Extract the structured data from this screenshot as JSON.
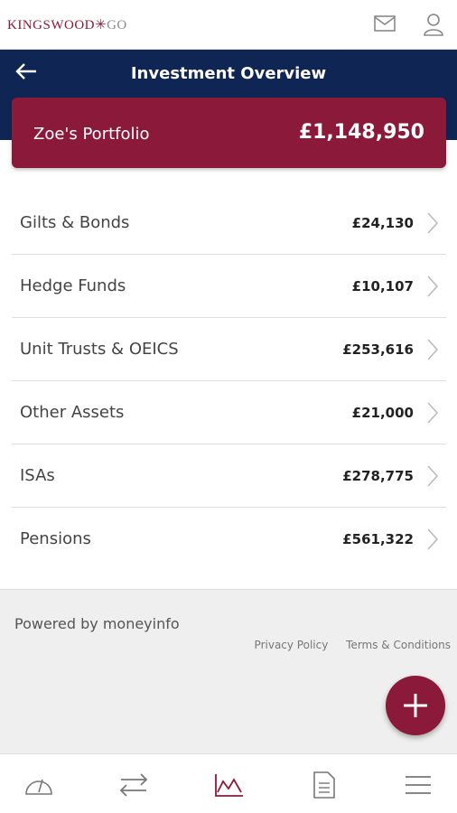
{
  "app": {
    "brand_left": "KINGSWOOD",
    "brand_sep": "✳",
    "brand_right": "GO"
  },
  "header": {
    "title": "Investment Overview"
  },
  "portfolio": {
    "name": "Zoe's Portfolio",
    "total": "£1,148,950"
  },
  "assets": [
    {
      "label": "Gilts & Bonds",
      "value": "£24,130"
    },
    {
      "label": "Hedge Funds",
      "value": "£10,107"
    },
    {
      "label": "Unit Trusts & OEICS",
      "value": "£253,616"
    },
    {
      "label": "Other Assets",
      "value": "£21,000"
    },
    {
      "label": "ISAs",
      "value": "£278,775"
    },
    {
      "label": "Pensions",
      "value": "£561,322"
    }
  ],
  "footer": {
    "powered": "Powered by moneyinfo",
    "privacy": "Privacy Policy",
    "terms": "Terms & Conditions"
  },
  "colors": {
    "navy": "#0f2655",
    "brand": "#8b1a3a"
  },
  "tabs": [
    "dashboard-icon",
    "transfer-icon",
    "chart-icon",
    "document-icon",
    "menu-icon"
  ]
}
